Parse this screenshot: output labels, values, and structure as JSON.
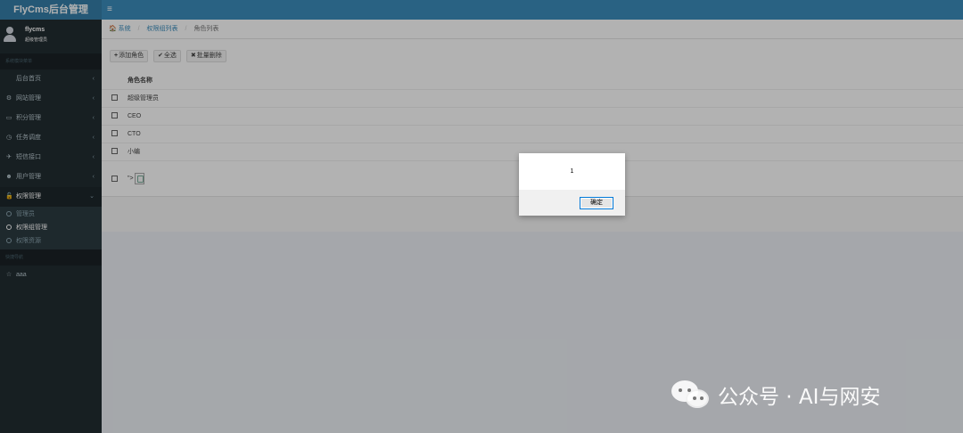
{
  "app": {
    "title": "FlyCms后台管理",
    "menu_icon": "≡"
  },
  "user": {
    "name": "flycms",
    "role": "超级管理员"
  },
  "sidebar": {
    "section_title": "系统模块菜单",
    "items": [
      {
        "label": "后台首页",
        "icon": ""
      },
      {
        "label": "网站管理",
        "icon": "gear-icon"
      },
      {
        "label": "积分管理",
        "icon": "card-icon"
      },
      {
        "label": "任务调度",
        "icon": "clock-icon"
      },
      {
        "label": "短信接口",
        "icon": "rocket-icon"
      },
      {
        "label": "用户管理",
        "icon": "users-icon"
      },
      {
        "label": "权限管理",
        "icon": "lock-icon"
      }
    ],
    "submenu": [
      {
        "label": "管理员"
      },
      {
        "label": "权限组管理"
      },
      {
        "label": "权限资源"
      }
    ],
    "section2_title": "快捷导航",
    "quick": [
      {
        "label": "aaa",
        "icon": "star-icon"
      }
    ]
  },
  "breadcrumb": {
    "home": "系统",
    "parent": "权限组列表",
    "current": "角色列表"
  },
  "toolbar": {
    "add": "添加角色",
    "select_all": "全选",
    "batch_delete": "批量删除"
  },
  "table": {
    "header": "角色名称",
    "rows": [
      "超级管理员",
      "CEO",
      "CTO",
      "小编"
    ],
    "xss_row_text": "\">"
  },
  "dialog": {
    "message": "1",
    "ok": "确定"
  },
  "watermark": {
    "text": "公众号 · AI与网安"
  }
}
